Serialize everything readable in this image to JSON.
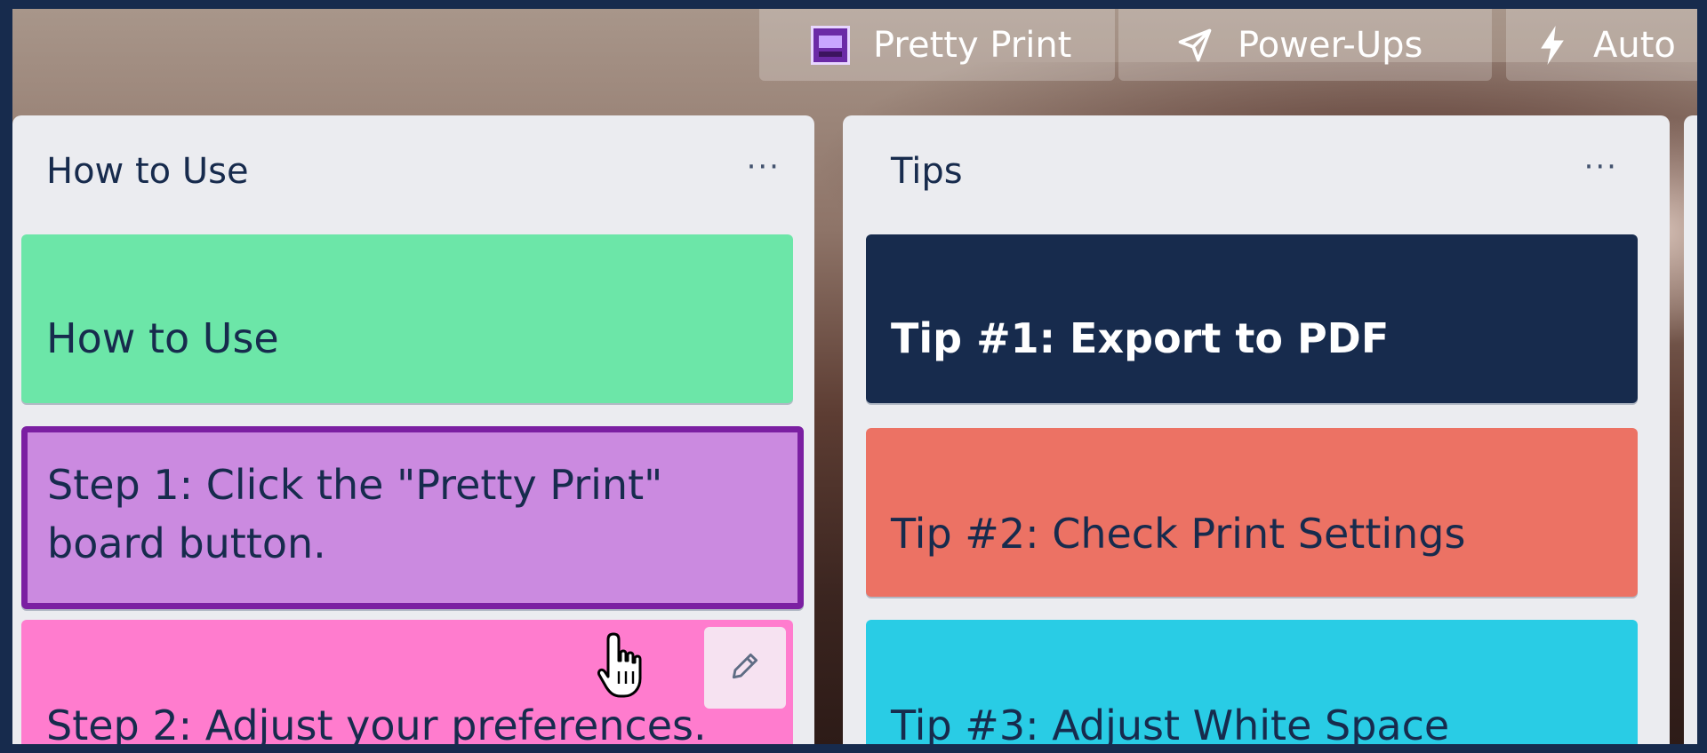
{
  "topbar": {
    "pretty_print": {
      "label": "Pretty Print",
      "icon": "pretty-print-logo"
    },
    "power_ups": {
      "label": "Power-Ups",
      "icon": "rocket-icon"
    },
    "automation": {
      "label": "Auto",
      "icon": "lightning-icon"
    }
  },
  "lists": [
    {
      "title": "How to Use",
      "menu": "···",
      "cards": [
        {
          "text": "How to Use",
          "color": "#6ce6a8"
        },
        {
          "text": "Step 1: Click the \"Pretty Print\" board button.",
          "color": "#cb8ae0",
          "border": "#7b1fa2"
        },
        {
          "text": "Step 2: Adjust your preferences.",
          "color": "#ff7cce"
        }
      ]
    },
    {
      "title": "Tips",
      "menu": "···",
      "cards": [
        {
          "text": "Tip #1: Export to PDF",
          "color": "#172b4d"
        },
        {
          "text": "Tip #2: Check Print Settings",
          "color": "#ec7264"
        },
        {
          "text": "Tip #3: Adjust White Space",
          "color": "#29cce5"
        }
      ]
    }
  ],
  "colors": {
    "frame": "#172b4d",
    "list_bg": "#ebecf0",
    "text_dark": "#172b4d"
  }
}
